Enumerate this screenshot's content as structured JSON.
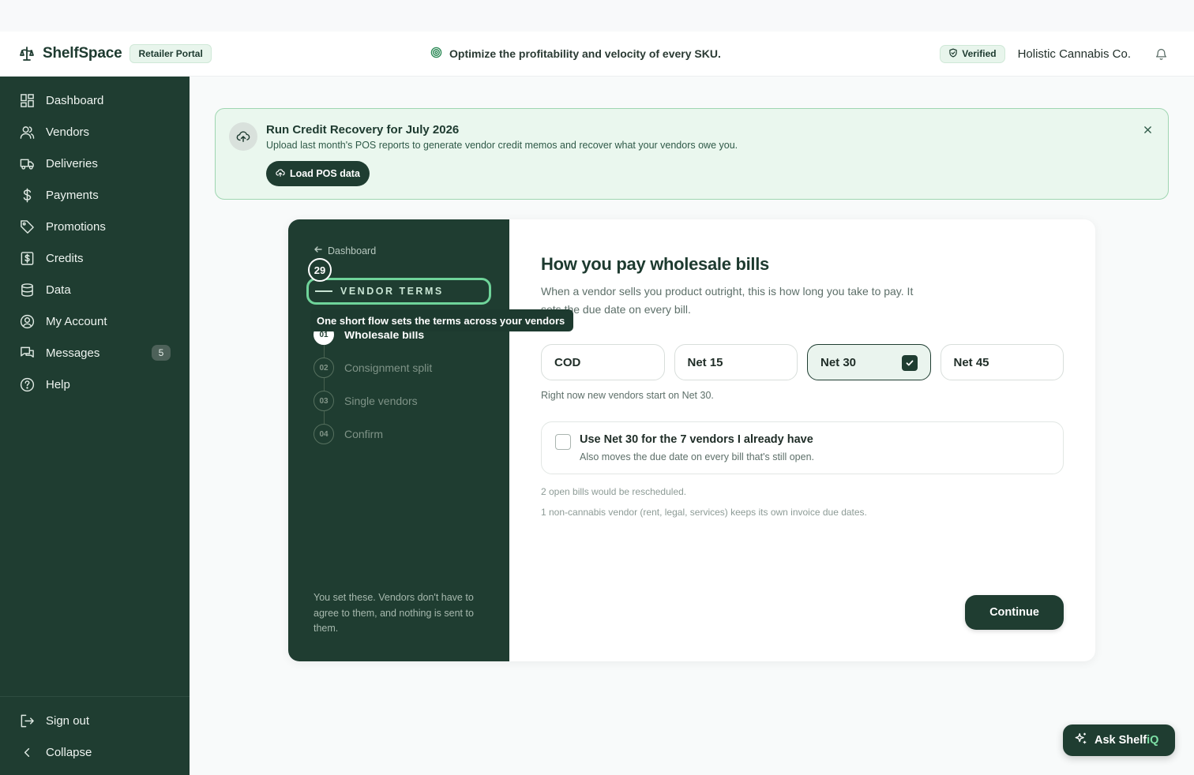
{
  "header": {
    "brand": "ShelfSpace",
    "portal_badge": "Retailer Portal",
    "tagline": "Optimize the profitability and velocity of every SKU.",
    "verified": "Verified",
    "company": "Holistic Cannabis Co."
  },
  "sidebar": {
    "items": [
      {
        "label": "Dashboard",
        "icon": "dashboard-grid-icon"
      },
      {
        "label": "Vendors",
        "icon": "users-icon"
      },
      {
        "label": "Deliveries",
        "icon": "truck-icon"
      },
      {
        "label": "Payments",
        "icon": "dollar-icon"
      },
      {
        "label": "Promotions",
        "icon": "tag-icon"
      },
      {
        "label": "Credits",
        "icon": "receipt-dollar-icon"
      },
      {
        "label": "Data",
        "icon": "database-icon"
      },
      {
        "label": "My Account",
        "icon": "user-circle-icon"
      },
      {
        "label": "Messages",
        "icon": "chat-icon",
        "badge": "5"
      },
      {
        "label": "Help",
        "icon": "help-circle-icon"
      }
    ],
    "bottom": [
      {
        "label": "Sign out",
        "icon": "sign-out-icon"
      },
      {
        "label": "Collapse",
        "icon": "chevron-left-icon"
      }
    ]
  },
  "banner": {
    "title": "Run Credit Recovery for July 2026",
    "text": "Upload last month's POS reports to generate vendor credit memos and recover what your vendors owe you.",
    "button": "Load POS data"
  },
  "wizard": {
    "back": "Dashboard",
    "step_counter": "29",
    "section": "VENDOR TERMS",
    "tooltip": "One short flow sets the terms across your vendors",
    "steps": [
      {
        "num": "01",
        "label": "Wholesale bills",
        "active": true
      },
      {
        "num": "02",
        "label": "Consignment split",
        "active": false
      },
      {
        "num": "03",
        "label": "Single vendors",
        "active": false
      },
      {
        "num": "04",
        "label": "Confirm",
        "active": false
      }
    ],
    "left_note": "You set these. Vendors don't have to agree to them, and nothing is sent to them.",
    "title": "How you pay wholesale bills",
    "subtitle": "When a vendor sells you product outright, this is how long you take to pay. It sets the due date on every bill.",
    "options": [
      "COD",
      "Net 15",
      "Net 30",
      "Net 45"
    ],
    "selected_option": "Net 30",
    "current_note": "Right now new vendors start on Net 30.",
    "apply_title": "Use Net 30 for the 7 vendors I already have",
    "apply_desc": "Also moves the due date on every bill that's still open.",
    "apply_checked": false,
    "note_rescheduled": "2 open bills would be rescheduled.",
    "note_noncannabis": "1 non-cannabis vendor (rent, legal, services) keeps its own invoice due dates.",
    "continue": "Continue"
  },
  "assistant": {
    "label_main": "Ask Shelf",
    "label_accent": "iQ"
  },
  "colors": {
    "sidebar_bg": "#1f3d31",
    "accent_green": "#6fd49a",
    "banner_bg": "#eaf7ee"
  }
}
